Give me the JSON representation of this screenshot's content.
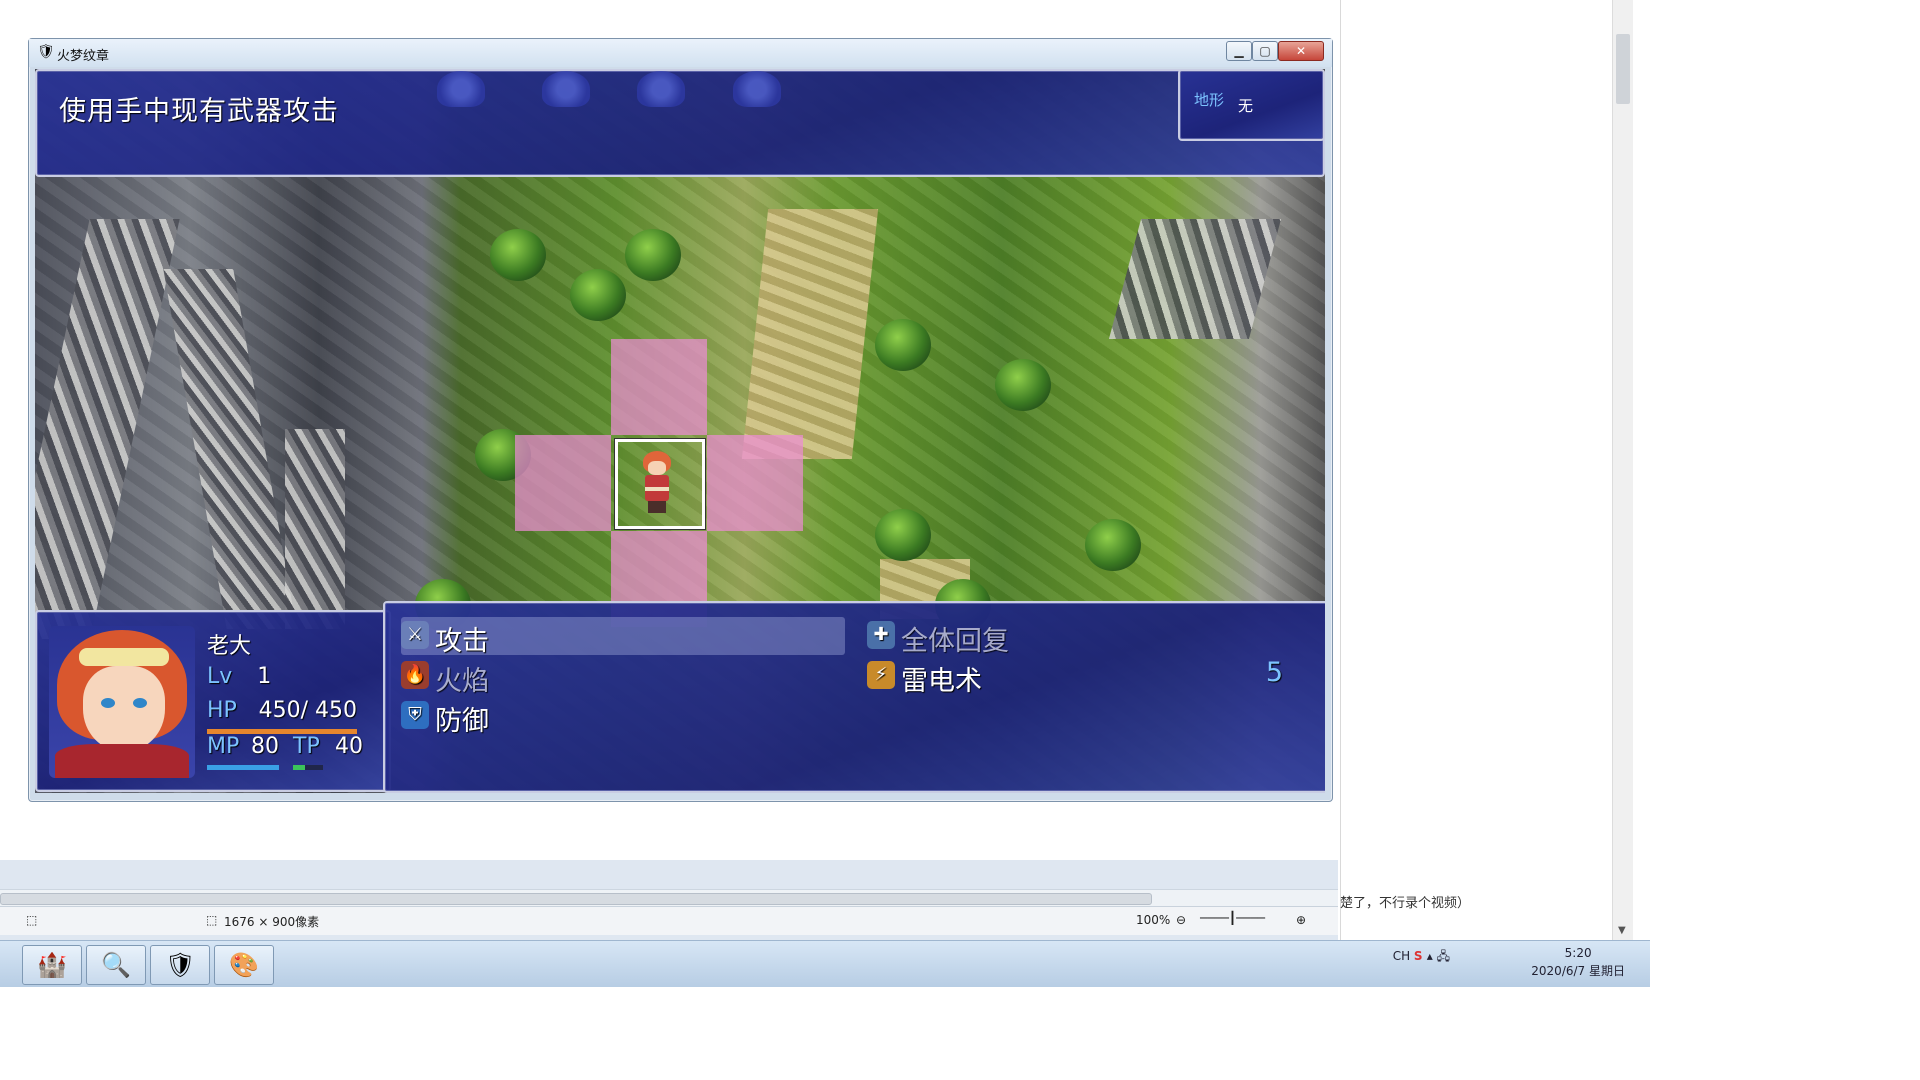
{
  "window": {
    "title": "火梦纹章"
  },
  "help": {
    "text": "使用手中现有武器攻击"
  },
  "terrain": {
    "label": "地形",
    "value": "无"
  },
  "actor": {
    "name": "老大",
    "lv_label": "Lv",
    "lv": "1",
    "hp_label": "HP",
    "hp": "450/ 450",
    "mp_label": "MP",
    "mp": "80",
    "tp_label": "TP",
    "tp": "40",
    "hp_fraction": 1.0,
    "mp_fraction": 1.0,
    "tp_fraction": 0.4,
    "colors": {
      "hp": "#e6862d",
      "mp": "#3aa0e6",
      "tp": "#3bc45a"
    }
  },
  "commands": [
    {
      "label": "攻击",
      "icon": "sword-icon",
      "selected": true,
      "enabled": true,
      "cost": ""
    },
    {
      "label": "火焰",
      "icon": "fire-icon",
      "selected": false,
      "enabled": false,
      "cost": ""
    },
    {
      "label": "防御",
      "icon": "shield-icon",
      "selected": false,
      "enabled": true,
      "cost": ""
    },
    {
      "label": "全体回复",
      "icon": "heal-icon",
      "selected": false,
      "enabled": false,
      "cost": ""
    },
    {
      "label": "雷电术",
      "icon": "lightning-icon",
      "selected": false,
      "enabled": true,
      "cost": "5"
    }
  ],
  "host": {
    "size_text": "1676 × 900像素",
    "zoom": "100%",
    "side_note": "楚了，不行录个视频）"
  },
  "taskbar": {
    "items": [
      "game-launcher-icon",
      "search-icon",
      "game-app-icon",
      "paint-icon"
    ],
    "tray_lang": "CH",
    "clock_time": "5:20",
    "clock_date": "2020/6/7 星期日"
  }
}
